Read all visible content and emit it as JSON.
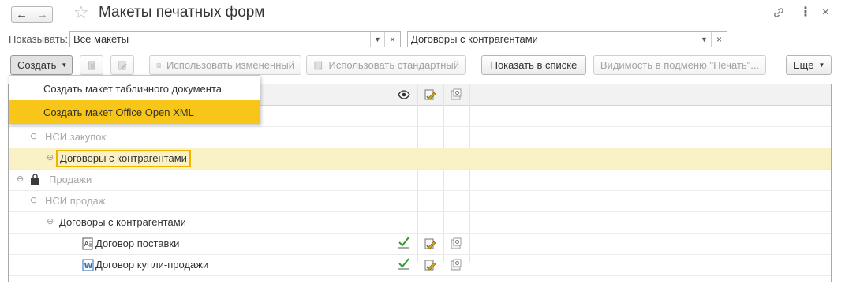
{
  "window": {
    "title": "Макеты печатных форм",
    "icons": [
      "back-arrow-icon",
      "forward-arrow-icon",
      "favorite-star-icon",
      "link-icon",
      "more-vertical-icon",
      "close-icon"
    ]
  },
  "filters": {
    "show_label": "Показывать:",
    "show_value": "Все макеты",
    "object_value": "Договоры с контрагентами"
  },
  "toolbar": {
    "create_label": "Создать",
    "use_modified_label": "Использовать измененный",
    "use_standard_label": "Использовать стандартный",
    "show_in_list_label": "Показать в списке",
    "print_visibility_label": "Видимость в подменю \"Печать\"...",
    "more_label": "Еще"
  },
  "create_menu": {
    "items": [
      "Создать макет табличного документа",
      "Создать макет Office Open XML"
    ],
    "highlight_color": "#f7c619"
  },
  "table": {
    "columns": [
      "eye-icon",
      "edit-pencil-icon",
      "template-icon"
    ],
    "rows": [
      {
        "level": 1,
        "text": "НСИ закупок",
        "expander": "⊖",
        "muted": true
      },
      {
        "level": 2,
        "text": "Договоры с контрагентами",
        "expander": "⊕",
        "selected": true
      },
      {
        "level": 0,
        "text": "Продажи",
        "expander": "⊖",
        "muted": true,
        "icon": "bag-icon"
      },
      {
        "level": 1,
        "text": "НСИ продаж",
        "expander": "⊖",
        "muted": true
      },
      {
        "level": 2,
        "text": "Договоры с контрагентами",
        "expander": "⊖"
      },
      {
        "level": 3,
        "text": "Договор поставки",
        "icon": "spreadsheet-template-icon",
        "used": true
      },
      {
        "level": 3,
        "text": "Договор купли-продажи",
        "icon": "word-document-icon",
        "used": true
      }
    ],
    "selection_color": "#fbf1c7",
    "focus_color": "#f0b400",
    "check_color": "#2e9a2e"
  }
}
